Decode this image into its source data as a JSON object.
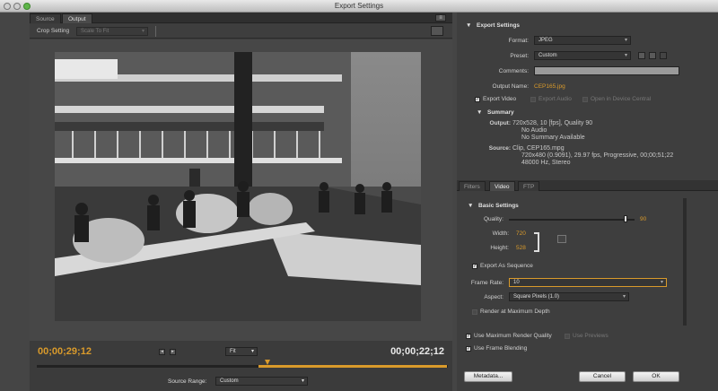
{
  "window": {
    "title": "Export Settings"
  },
  "left_tabs": {
    "source": "Source",
    "output": "Output"
  },
  "crop": {
    "label": "Crop Setting",
    "value": "Scale To Fit"
  },
  "timeline": {
    "current_timecode": "00;00;29;12",
    "end_timecode": "00;00;22;12",
    "fit_value": "Fit",
    "source_range_label": "Source Range:",
    "source_range_value": "Custom"
  },
  "export_settings": {
    "heading": "Export Settings",
    "format_label": "Format:",
    "format_value": "JPEG",
    "preset_label": "Preset:",
    "preset_value": "Custom",
    "comments_label": "Comments:",
    "output_name_label": "Output Name:",
    "output_name_value": "CEP165.jpg",
    "export_video_label": "Export Video",
    "export_audio_label": "Export Audio",
    "open_device_central_label": "Open in Device Central"
  },
  "summary": {
    "heading": "Summary",
    "output_label": "Output:",
    "output_lines": [
      "720x528, 10 [fps], Quality 90",
      "No Audio",
      "No Summary Available"
    ],
    "source_label": "Source:",
    "source_lines": [
      "Clip, CEP165.mpg",
      "720x480 (0.9091), 29.97 fps, Progressive, 00;00;51;22",
      "48000 Hz, Stereo"
    ]
  },
  "right_tabs": {
    "filters": "Filters",
    "video": "Video",
    "ftp": "FTP"
  },
  "basic_settings": {
    "heading": "Basic Settings",
    "quality_label": "Quality:",
    "quality_value": "90",
    "width_label": "Width:",
    "width_value": "720",
    "height_label": "Height:",
    "height_value": "528",
    "export_sequence_label": "Export As Sequence",
    "frame_rate_label": "Frame Rate:",
    "frame_rate_value": "10",
    "aspect_label": "Aspect:",
    "aspect_value": "Square Pixels (1.0)",
    "render_max_depth_label": "Render at Maximum Depth"
  },
  "bottom": {
    "max_render_quality_label": "Use Maximum Render Quality",
    "use_previews_label": "Use Previews",
    "frame_blending_label": "Use Frame Blending",
    "metadata_button": "Metadata...",
    "cancel_button": "Cancel",
    "ok_button": "OK"
  },
  "colors": {
    "accent": "#d99a2b"
  }
}
